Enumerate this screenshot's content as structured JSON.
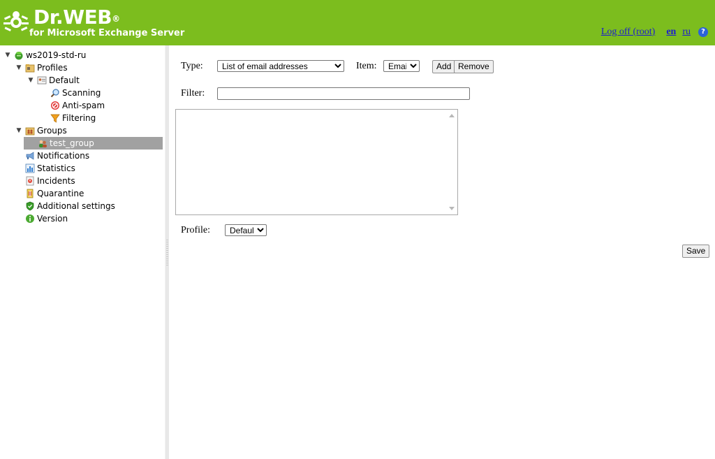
{
  "header": {
    "brand": "Dr.WEB",
    "brand_mark": "®",
    "subtitle": "for Microsoft Exchange Server",
    "logoff_label": "Log off (root)",
    "lang_en": "en",
    "lang_ru": "ru",
    "help_symbol": "?",
    "colors": {
      "bar": "#7cbd1e",
      "link": "#1c1ccf"
    }
  },
  "tree": {
    "root": "ws2019-std-ru",
    "profiles": "Profiles",
    "default": "Default",
    "scanning": "Scanning",
    "antispam": "Anti-spam",
    "filtering": "Filtering",
    "groups": "Groups",
    "test_group": "test_group",
    "notifications": "Notifications",
    "statistics": "Statistics",
    "incidents": "Incidents",
    "quarantine": "Quarantine",
    "additional_settings": "Additional settings",
    "version": "Version"
  },
  "form": {
    "type_label": "Type:",
    "type_value": "List of email addresses",
    "item_label": "Item:",
    "item_value": "Email",
    "add_label": "Add",
    "remove_label": "Remove",
    "filter_label": "Filter:",
    "filter_value": "",
    "profile_label": "Profile:",
    "profile_value": "Default",
    "save_label": "Save"
  }
}
